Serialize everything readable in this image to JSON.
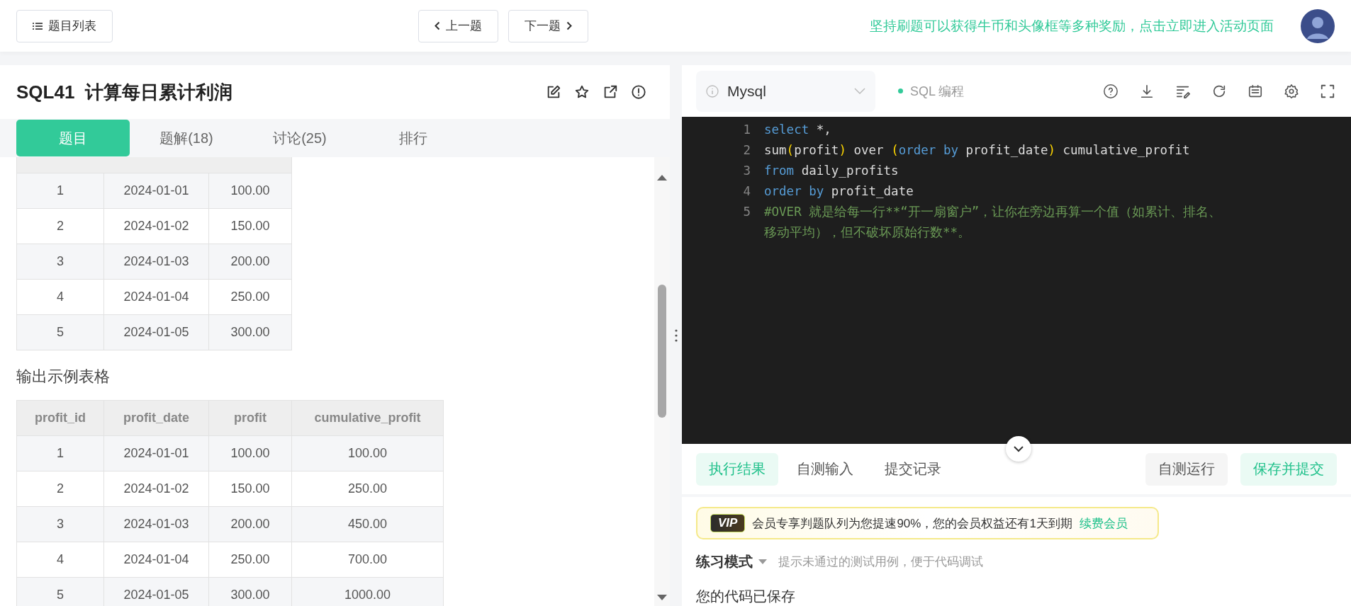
{
  "top_bar": {
    "problem_list_button": "题目列表",
    "prev_button": "上一题",
    "next_button": "下一题",
    "promo_link": "坚持刷题可以获得牛币和头像框等多种奖励，点击立即进入活动页面"
  },
  "problem": {
    "title": "SQL41  计算每日累计利润",
    "tabs": [
      {
        "label": "题目",
        "selected": true
      },
      {
        "label": "题解(18)",
        "selected": false
      },
      {
        "label": "讨论(25)",
        "selected": false
      },
      {
        "label": "排行",
        "selected": false
      }
    ]
  },
  "input_table": {
    "rows": [
      [
        "1",
        "2024-01-01",
        "100.00"
      ],
      [
        "2",
        "2024-01-02",
        "150.00"
      ],
      [
        "3",
        "2024-01-03",
        "200.00"
      ],
      [
        "4",
        "2024-01-04",
        "250.00"
      ],
      [
        "5",
        "2024-01-05",
        "300.00"
      ]
    ]
  },
  "output_caption": "输出示例表格",
  "output_table": {
    "columns": [
      "profit_id",
      "profit_date",
      "profit",
      "cumulative_profit"
    ],
    "rows": [
      [
        "1",
        "2024-01-01",
        "100.00",
        "100.00"
      ],
      [
        "2",
        "2024-01-02",
        "150.00",
        "250.00"
      ],
      [
        "3",
        "2024-01-03",
        "200.00",
        "450.00"
      ],
      [
        "4",
        "2024-01-04",
        "250.00",
        "700.00"
      ],
      [
        "5",
        "2024-01-05",
        "300.00",
        "1000.00"
      ]
    ]
  },
  "editor": {
    "language": "Mysql",
    "mode_label": "SQL 编程",
    "lines": [
      {
        "number": "1",
        "tokens": [
          {
            "kind": "keyword",
            "text": "select"
          },
          {
            "kind": "plain",
            "text": " *,"
          }
        ]
      },
      {
        "number": "2",
        "tokens": [
          {
            "kind": "plain",
            "text": "sum"
          },
          {
            "kind": "bracket",
            "text": "("
          },
          {
            "kind": "plain",
            "text": "profit"
          },
          {
            "kind": "bracket",
            "text": ")"
          },
          {
            "kind": "plain",
            "text": " over "
          },
          {
            "kind": "bracket",
            "text": "("
          },
          {
            "kind": "keyword",
            "text": "order by"
          },
          {
            "kind": "plain",
            "text": " profit_date"
          },
          {
            "kind": "bracket",
            "text": ")"
          },
          {
            "kind": "plain",
            "text": " cumulative_profit"
          }
        ]
      },
      {
        "number": "3",
        "tokens": [
          {
            "kind": "keyword",
            "text": "from"
          },
          {
            "kind": "plain",
            "text": " daily_profits"
          }
        ]
      },
      {
        "number": "4",
        "tokens": [
          {
            "kind": "keyword",
            "text": "order by"
          },
          {
            "kind": "plain",
            "text": " profit_date"
          }
        ]
      },
      {
        "number": "5",
        "tokens": [
          {
            "kind": "comment",
            "text": "#OVER 就是给每一行**“开一扇窗户”，让你在旁边再算一个值（如累计、排名、移动平均），但不破坏原始行数**。"
          }
        ]
      }
    ]
  },
  "result_panel": {
    "tabs": [
      {
        "label": "执行结果",
        "selected": true
      },
      {
        "label": "自测输入",
        "selected": false
      },
      {
        "label": "提交记录",
        "selected": false
      }
    ],
    "run_button": "自测运行",
    "submit_button": "保存并提交",
    "vip": {
      "badge": "VIP",
      "message": "会员专享判题队列为您提速90%，您的会员权益还有1天到期",
      "link": "续费会员"
    },
    "practice_mode": {
      "label": "练习模式",
      "hint": "提示未通过的测试用例，便于代码调试"
    },
    "status": "您的代码已保存"
  }
}
